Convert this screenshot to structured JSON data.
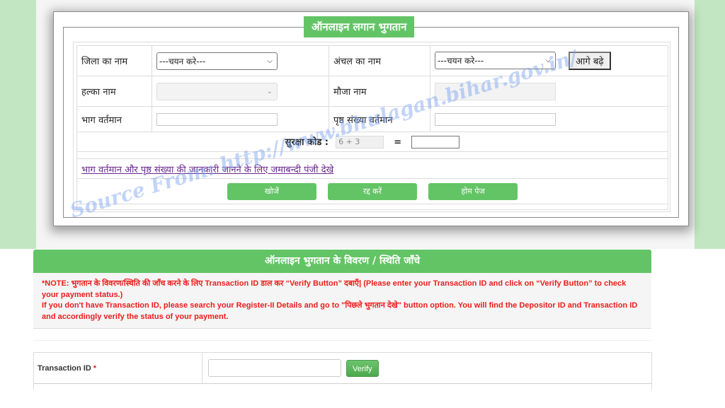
{
  "form": {
    "legend": "ऑनलाइन लगान भुगतान",
    "district_label": "जिला का नाम",
    "district_select": "---चयन करे---",
    "circle_label": "अंचल का नाम",
    "circle_select": "---चयन करे---",
    "next_button": "आगे बढ़े",
    "halka_label": "हल्का नाम",
    "mauja_label": "मौजा नाम",
    "bhag_label": "भाग वर्तमान",
    "page_label": "पृष्ठ संख्या वर्तमान",
    "captcha_label": "सुरक्षा कोड :",
    "captcha_question": "6 + 3",
    "captcha_equals": "=",
    "jamabandi_link": "भाग वर्तमान और पृष्ठ संख्या की जानकारी जानने के लिए जमाबन्दी पंजी देखे",
    "search_button": "खोजें",
    "cancel_button": "रद्द करें",
    "home_button": "होम पेज"
  },
  "watermark": "Source From: http://www.bhulagan.bihar.gov.in/",
  "status": {
    "header": "ऑनलाइन भुगतान के विवरण / स्थिति जाँचे",
    "note_line1": "*NOTE: भुगतान के विवरण/स्थिति की जाँच करने के लिए Transaction ID डाल कर “Verify Button” दबाएँ| (Please enter your Transaction ID and click on “Verify Button” to check your payment status.)",
    "note_line2": "If you don't have Transaction ID, please search your Register-II Details and go to \"पिछले भुगतान देखे\" button option. You will find the Depositor ID and Transaction ID and accordingly verify the status of your payment.",
    "txn_label": "Transaction ID",
    "required_mark": "*",
    "txn_value": "",
    "verify_button": "Verify"
  },
  "colors": {
    "accent_green": "#63c466",
    "note_red": "#ee1c1c",
    "link_purple": "#6a2a8c",
    "band_green": "#c2e6c1"
  }
}
